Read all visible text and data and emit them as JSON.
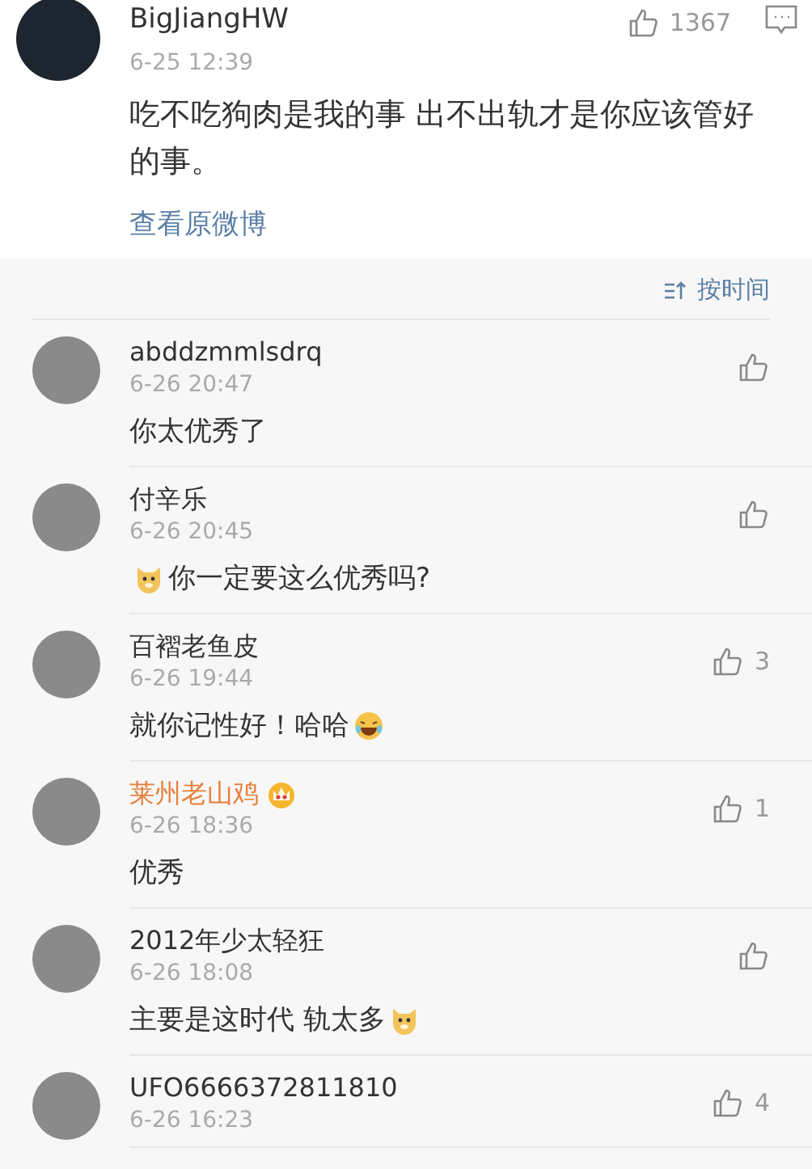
{
  "post": {
    "author": "BigJiangHW",
    "date": "6-25 12:39",
    "likes": "1367",
    "text": "吃不吃狗肉是我的事 出不出轨才是你应该管好的事。",
    "link": "查看原微博"
  },
  "sort": {
    "label": "按时间"
  },
  "comments": [
    {
      "name": "abddzmmlsdrq",
      "vip": false,
      "date": "6-26 20:47",
      "parts": [
        {
          "kind": "text",
          "text": "你太优秀了"
        }
      ]
    },
    {
      "name": "付辛乐",
      "vip": false,
      "date": "6-26 20:45",
      "parts": [
        {
          "kind": "doge"
        },
        {
          "kind": "text",
          "text": "你一定要这么优秀吗?"
        }
      ]
    },
    {
      "name": "百褶老鱼皮",
      "vip": false,
      "date": "6-26 19:44",
      "likes": "3",
      "parts": [
        {
          "kind": "text",
          "text": "就你记性好！哈哈"
        },
        {
          "kind": "laugh"
        }
      ]
    },
    {
      "name": "莱州老山鸡",
      "vip": true,
      "date": "6-26 18:36",
      "likes": "1",
      "parts": [
        {
          "kind": "text",
          "text": "优秀"
        }
      ]
    },
    {
      "name": "2012年少太轻狂",
      "vip": false,
      "date": "6-26 18:08",
      "parts": [
        {
          "kind": "text",
          "text": "主要是这时代  轨太多"
        },
        {
          "kind": "doge"
        }
      ]
    },
    {
      "name": "UFO6666372811810",
      "vip": false,
      "date": "6-26 16:23",
      "likes": "4"
    }
  ]
}
